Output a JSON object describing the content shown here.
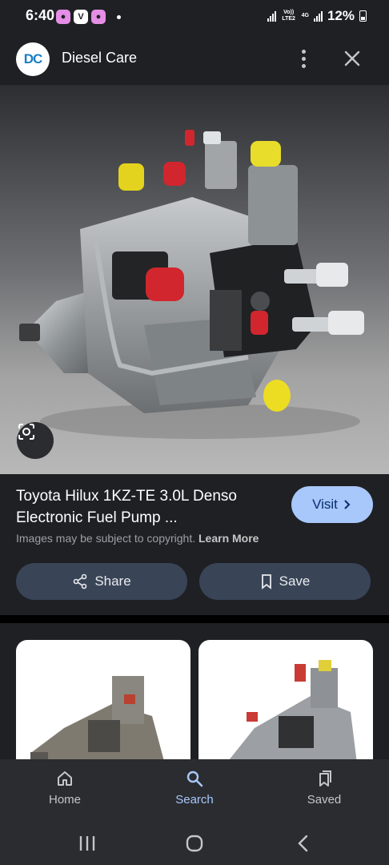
{
  "status_bar": {
    "time": "6:40",
    "network_top": "Vo)) LTE2",
    "network_type": "4G",
    "battery": "12%"
  },
  "header": {
    "logo_text": "DC",
    "site_name": "Diesel Care",
    "more_icon": "more-vert-icon",
    "close_icon": "close-icon"
  },
  "result": {
    "title": "Toyota Hilux 1KZ-TE 3.0L Denso Electronic Fuel Pump ...",
    "visit_label": "Visit",
    "copyright_text": "Images may be subject to copyright.",
    "learn_more": "Learn More",
    "share_label": "Share",
    "save_label": "Save"
  },
  "bottom_nav": {
    "items": [
      {
        "label": "Home",
        "icon": "home-icon"
      },
      {
        "label": "Search",
        "icon": "search-icon"
      },
      {
        "label": "Saved",
        "icon": "bookmark-icon"
      }
    ]
  },
  "colors": {
    "accent": "#a8c7fa",
    "background": "#1f2024",
    "pill": "#394457"
  }
}
